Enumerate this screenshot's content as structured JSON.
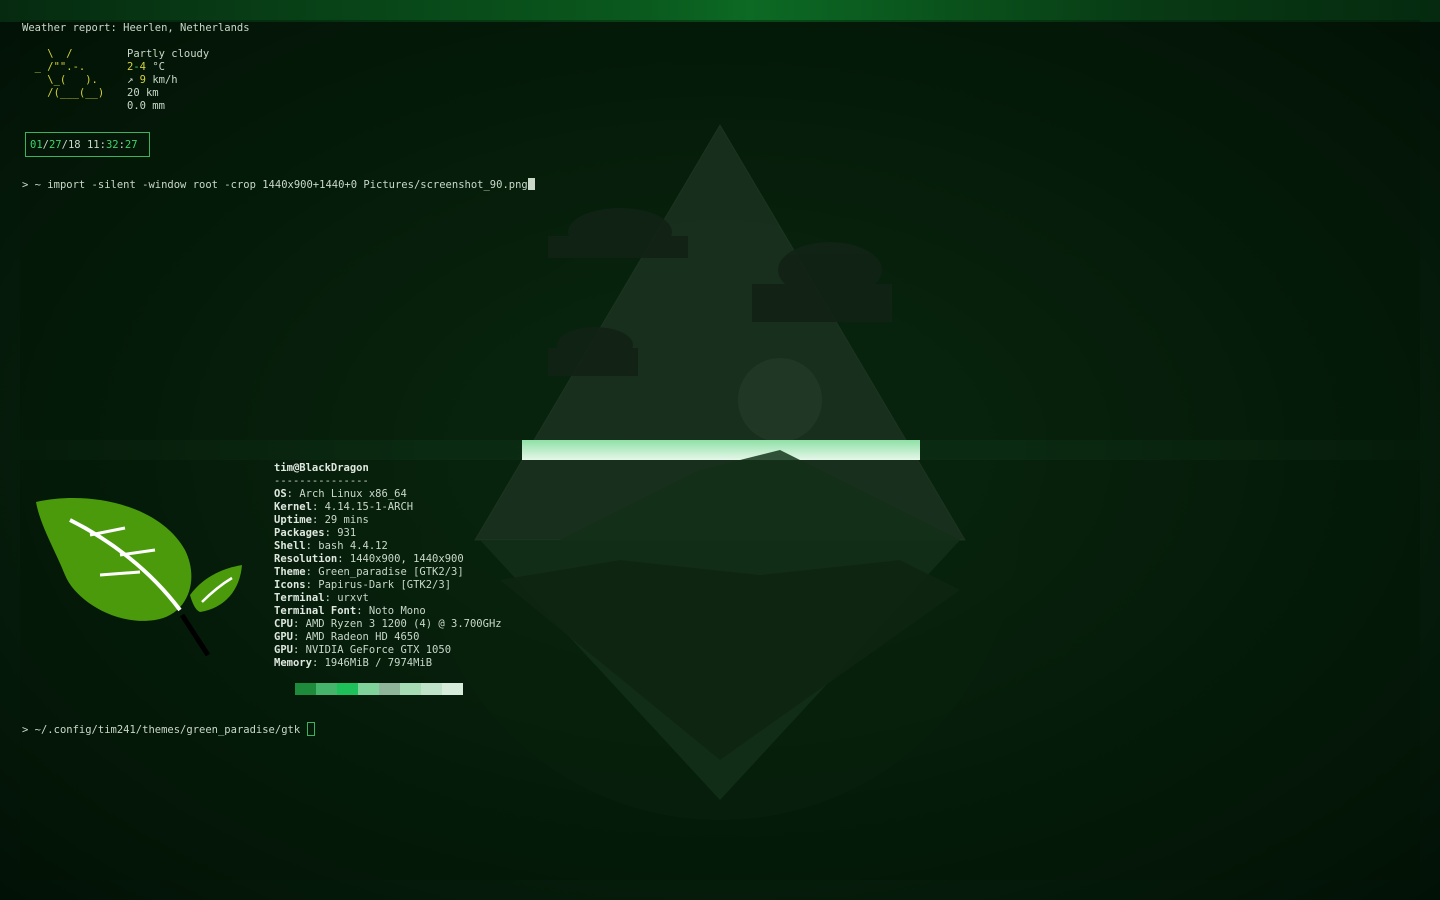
{
  "colors": {
    "accent": "#3bb25e",
    "leaf_green": "#4a9a0c",
    "terminal_text": "#c9d8c9",
    "highlight_yellow": "#d6d23a"
  },
  "weather": {
    "header": "Weather report: Heerlen, Netherlands",
    "ascii": [
      "    \\  /",
      "  _ /\"\".-.",
      "    \\_(   ).",
      "    /(___(__)"
    ],
    "condition": "Partly cloudy",
    "temp_low": "2",
    "temp_high": "4",
    "temp_unit": "°C",
    "wind_arrow": "↗",
    "wind_speed": "9",
    "wind_unit": "km/h",
    "visibility": "20 km",
    "precipitation": "0.0 mm"
  },
  "clock": {
    "month": "01",
    "day": "27",
    "year": "18",
    "hour": "11",
    "minute": "32",
    "second": "27"
  },
  "commands": {
    "prompt": ">",
    "first": "~ import -silent -window root -crop 1440x900+1440+0 Pictures/screenshot_90.png",
    "second": "~/.config/tim241/themes/green_paradise/gtk"
  },
  "neofetch": {
    "user_host": "tim@BlackDragon",
    "separator": "---------------",
    "rows": [
      {
        "key": "OS",
        "value": "Arch Linux x86_64"
      },
      {
        "key": "Kernel",
        "value": "4.14.15-1-ARCH"
      },
      {
        "key": "Uptime",
        "value": "29 mins"
      },
      {
        "key": "Packages",
        "value": "931"
      },
      {
        "key": "Shell",
        "value": "bash 4.4.12"
      },
      {
        "key": "Resolution",
        "value": "1440x900, 1440x900"
      },
      {
        "key": "Theme",
        "value": "Green_paradise [GTK2/3]"
      },
      {
        "key": "Icons",
        "value": "Papirus-Dark [GTK2/3]"
      },
      {
        "key": "Terminal",
        "value": "urxvt"
      },
      {
        "key": "Terminal Font",
        "value": "Noto Mono"
      },
      {
        "key": "CPU",
        "value": "AMD Ryzen 3 1200 (4) @ 3.700GHz"
      },
      {
        "key": "GPU",
        "value": "AMD Radeon HD 4650"
      },
      {
        "key": "GPU",
        "value": "NVIDIA GeForce GTX 1050"
      },
      {
        "key": "Memory",
        "value": "1946MiB / 7974MiB"
      }
    ],
    "palette": [
      "#1e8a3c",
      "#44b56a",
      "#1ec05a",
      "#7fd39a",
      "#8fb59a",
      "#a6dbb4",
      "#bfe3c8",
      "#d8ecdc"
    ]
  }
}
